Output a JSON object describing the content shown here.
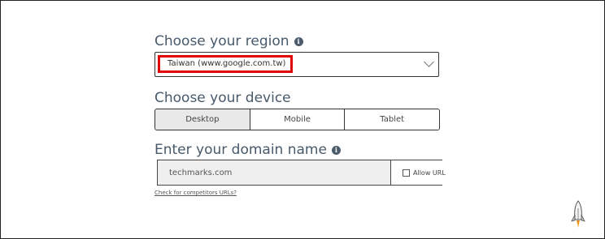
{
  "region": {
    "heading": "Choose your region",
    "info_icon": "info-icon",
    "selected_value": "Taiwan (www.google.com.tw)",
    "highlight_color": "#e00000"
  },
  "device": {
    "heading": "Choose your device",
    "options": [
      "Desktop",
      "Mobile",
      "Tablet"
    ],
    "selected": "Desktop"
  },
  "domain": {
    "heading": "Enter your domain name",
    "info_icon": "info-icon",
    "placeholder": "techmarks.com",
    "allow_url_label": "Allow URL",
    "competitor_link": "Check for competitors URLs?"
  },
  "decor": {
    "rocket_icon": "rocket-icon"
  }
}
